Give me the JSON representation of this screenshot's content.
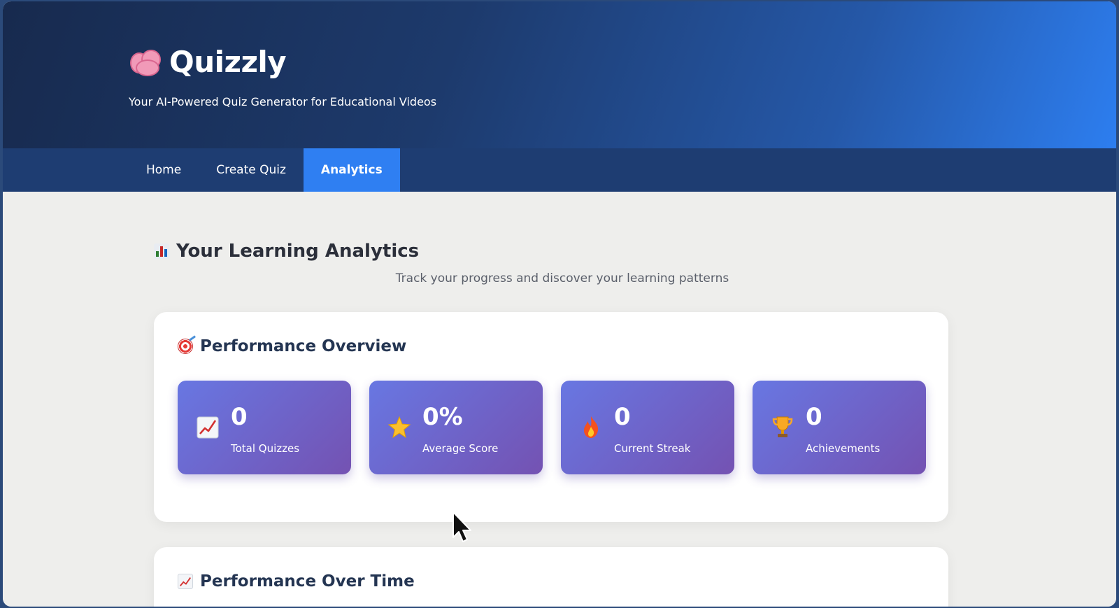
{
  "app": {
    "title": "Quizzly",
    "tagline": "Your AI-Powered Quiz Generator for Educational Videos",
    "logo_icon": "brain-icon"
  },
  "nav": {
    "items": [
      {
        "label": "Home",
        "active": false
      },
      {
        "label": "Create Quiz",
        "active": false
      },
      {
        "label": "Analytics",
        "active": true
      }
    ]
  },
  "analytics": {
    "title": "Your Learning Analytics",
    "title_icon": "bar-chart-icon",
    "subtitle": "Track your progress and discover your learning patterns"
  },
  "overview": {
    "title": "Performance Overview",
    "title_icon": "target-icon",
    "stats": [
      {
        "value": "0",
        "label": "Total Quizzes",
        "icon": "chart-increasing-icon"
      },
      {
        "value": "0%",
        "label": "Average Score",
        "icon": "star-icon"
      },
      {
        "value": "0",
        "label": "Current Streak",
        "icon": "fire-icon"
      },
      {
        "value": "0",
        "label": "Achievements",
        "icon": "trophy-icon"
      }
    ]
  },
  "performance_over_time": {
    "title": "Performance Over Time",
    "title_icon": "chart-increasing-icon"
  },
  "colors": {
    "nav_bg": "#1e3d72",
    "nav_active": "#2f7ff2",
    "stat_gradient_start": "#6877e2",
    "stat_gradient_end": "#7452b2",
    "page_bg": "#eeeeec"
  }
}
